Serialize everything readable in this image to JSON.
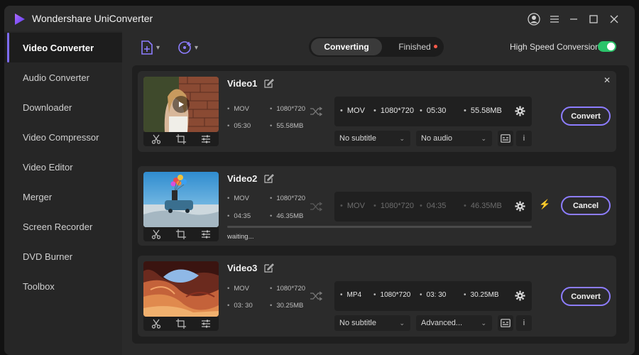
{
  "app": {
    "title": "Wondershare UniConverter"
  },
  "titlebar_icons": [
    "account-icon",
    "menu-icon",
    "minimize-icon",
    "maximize-icon",
    "close-icon"
  ],
  "sidebar": {
    "items": [
      {
        "label": "Video Converter",
        "active": true
      },
      {
        "label": "Audio Converter"
      },
      {
        "label": "Downloader"
      },
      {
        "label": "Video Compressor"
      },
      {
        "label": "Video Editor"
      },
      {
        "label": "Merger"
      },
      {
        "label": "Screen Recorder"
      },
      {
        "label": "DVD Burner"
      },
      {
        "label": "Toolbox"
      }
    ]
  },
  "toolbar": {
    "tabs": {
      "converting": "Converting",
      "finished": "Finished"
    },
    "high_speed": {
      "label": "High Speed Conversion",
      "enabled": true
    }
  },
  "colors": {
    "accent": "#8d7dff",
    "toggle_on": "#2bc36a",
    "notify_dot": "#ff5a4a",
    "bolt": "#f2b21c"
  },
  "videos": [
    {
      "title": "Video1",
      "src": {
        "format": "MOV",
        "resolution": "1080*720",
        "duration": "05:30",
        "size": "55.58MB"
      },
      "out": {
        "format": "MOV",
        "resolution": "1080*720",
        "duration": "05:30",
        "size": "55.58MB"
      },
      "subtitle": "No subtitle",
      "audio": "No audio",
      "action": "Convert"
    },
    {
      "title": "Video2",
      "src": {
        "format": "MOV",
        "resolution": "1080*720",
        "duration": "04:35",
        "size": "46.35MB"
      },
      "out": {
        "format": "MOV",
        "resolution": "1080*720",
        "duration": "04:35",
        "size": "46.35MB"
      },
      "status": "waiting...",
      "progress": 0,
      "action": "Cancel"
    },
    {
      "title": "Video3",
      "src": {
        "format": "MOV",
        "resolution": "1080*720",
        "duration": "03: 30",
        "size": "30.25MB"
      },
      "out": {
        "format": "MP4",
        "resolution": "1080*720",
        "duration": "03: 30",
        "size": "30.25MB"
      },
      "subtitle": "No subtitle",
      "audio": "Advanced...",
      "action": "Convert"
    }
  ],
  "info_label": "i"
}
